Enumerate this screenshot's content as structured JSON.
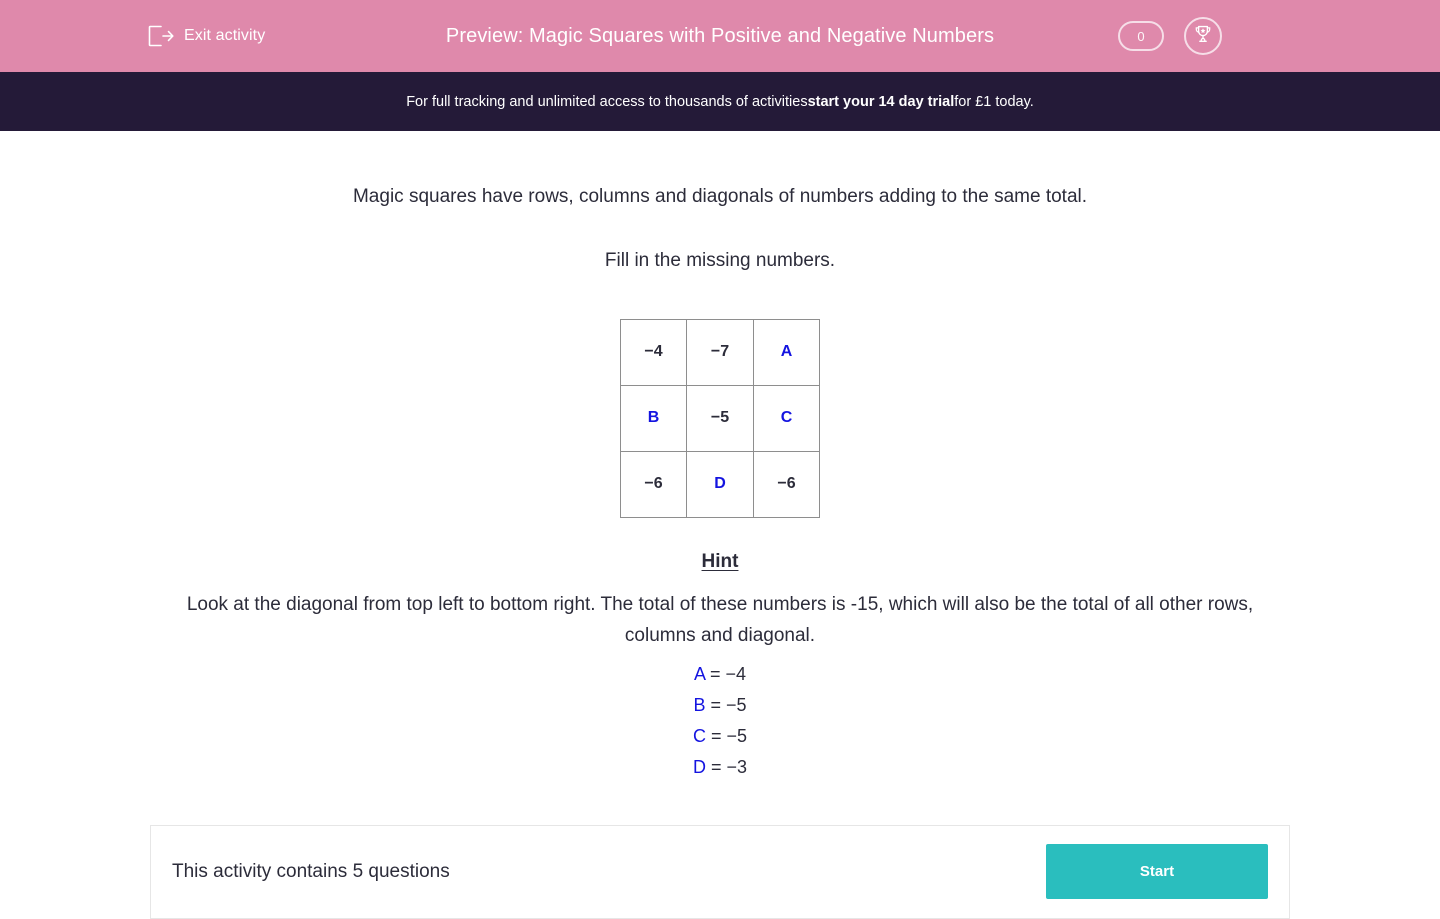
{
  "topbar": {
    "exit_label": "Exit activity",
    "exit_icon": "exit-arrow-icon",
    "title": "Preview: Magic Squares with Positive and Negative Numbers",
    "score_value": "0",
    "trophy_icon": "trophy-icon",
    "background_color": "#df89ab"
  },
  "promo": {
    "text_before": "For full tracking and unlimited access to thousands of activities ",
    "text_bold": "start your 14 day trial",
    "text_after": " for £1 today.",
    "background_color": "#241a38"
  },
  "main": {
    "intro_line_1": "Magic squares have rows, columns and diagonals of numbers adding to the same total.",
    "intro_line_2": "Fill in the missing numbers.",
    "grid": {
      "rows": [
        [
          {
            "value": "−4",
            "unknown": false
          },
          {
            "value": "−7",
            "unknown": false
          },
          {
            "value": "A",
            "unknown": true
          }
        ],
        [
          {
            "value": "B",
            "unknown": true
          },
          {
            "value": "−5",
            "unknown": false
          },
          {
            "value": "C",
            "unknown": true
          }
        ],
        [
          {
            "value": "−6",
            "unknown": false
          },
          {
            "value": "D",
            "unknown": true
          },
          {
            "value": "−6",
            "unknown": false
          }
        ]
      ],
      "unknown_color": "#1414e0",
      "known_color": "#2c2c3a"
    },
    "hint": {
      "title": "Hint",
      "body": "Look at the diagonal from top left to bottom right.  The total of these numbers is -15, which will also be the total of all other rows, columns and diagonal.",
      "answers": [
        {
          "letter": "A",
          "rest": " = −4"
        },
        {
          "letter": "B",
          "rest": " = −5"
        },
        {
          "letter": "C",
          "rest": " = −5"
        },
        {
          "letter": "D",
          "rest": " = −3"
        }
      ]
    }
  },
  "footer": {
    "question_count_text": "This activity contains 5 questions",
    "start_label": "Start",
    "start_color": "#2abebe"
  }
}
